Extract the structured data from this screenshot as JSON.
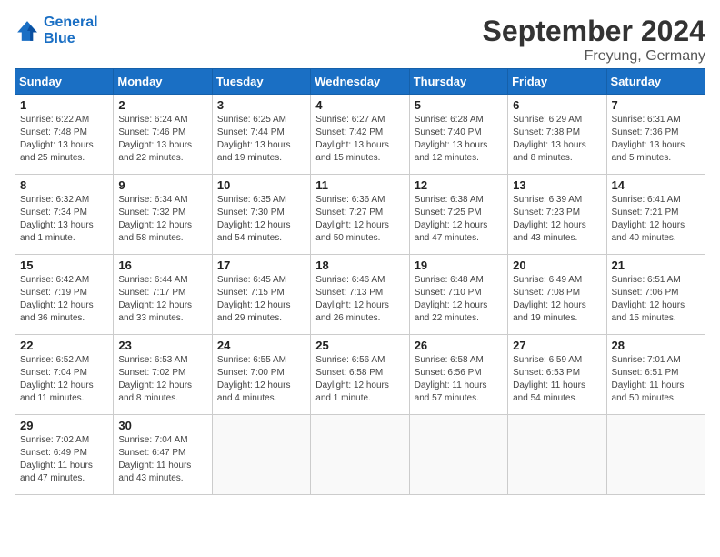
{
  "header": {
    "logo_line1": "General",
    "logo_line2": "Blue",
    "month_title": "September 2024",
    "location": "Freyung, Germany"
  },
  "days_of_week": [
    "Sunday",
    "Monday",
    "Tuesday",
    "Wednesday",
    "Thursday",
    "Friday",
    "Saturday"
  ],
  "weeks": [
    [
      {
        "day": 1,
        "sunrise": "6:22 AM",
        "sunset": "7:48 PM",
        "daylight": "13 hours and 25 minutes."
      },
      {
        "day": 2,
        "sunrise": "6:24 AM",
        "sunset": "7:46 PM",
        "daylight": "13 hours and 22 minutes."
      },
      {
        "day": 3,
        "sunrise": "6:25 AM",
        "sunset": "7:44 PM",
        "daylight": "13 hours and 19 minutes."
      },
      {
        "day": 4,
        "sunrise": "6:27 AM",
        "sunset": "7:42 PM",
        "daylight": "13 hours and 15 minutes."
      },
      {
        "day": 5,
        "sunrise": "6:28 AM",
        "sunset": "7:40 PM",
        "daylight": "13 hours and 12 minutes."
      },
      {
        "day": 6,
        "sunrise": "6:29 AM",
        "sunset": "7:38 PM",
        "daylight": "13 hours and 8 minutes."
      },
      {
        "day": 7,
        "sunrise": "6:31 AM",
        "sunset": "7:36 PM",
        "daylight": "13 hours and 5 minutes."
      }
    ],
    [
      {
        "day": 8,
        "sunrise": "6:32 AM",
        "sunset": "7:34 PM",
        "daylight": "13 hours and 1 minute."
      },
      {
        "day": 9,
        "sunrise": "6:34 AM",
        "sunset": "7:32 PM",
        "daylight": "12 hours and 58 minutes."
      },
      {
        "day": 10,
        "sunrise": "6:35 AM",
        "sunset": "7:30 PM",
        "daylight": "12 hours and 54 minutes."
      },
      {
        "day": 11,
        "sunrise": "6:36 AM",
        "sunset": "7:27 PM",
        "daylight": "12 hours and 50 minutes."
      },
      {
        "day": 12,
        "sunrise": "6:38 AM",
        "sunset": "7:25 PM",
        "daylight": "12 hours and 47 minutes."
      },
      {
        "day": 13,
        "sunrise": "6:39 AM",
        "sunset": "7:23 PM",
        "daylight": "12 hours and 43 minutes."
      },
      {
        "day": 14,
        "sunrise": "6:41 AM",
        "sunset": "7:21 PM",
        "daylight": "12 hours and 40 minutes."
      }
    ],
    [
      {
        "day": 15,
        "sunrise": "6:42 AM",
        "sunset": "7:19 PM",
        "daylight": "12 hours and 36 minutes."
      },
      {
        "day": 16,
        "sunrise": "6:44 AM",
        "sunset": "7:17 PM",
        "daylight": "12 hours and 33 minutes."
      },
      {
        "day": 17,
        "sunrise": "6:45 AM",
        "sunset": "7:15 PM",
        "daylight": "12 hours and 29 minutes."
      },
      {
        "day": 18,
        "sunrise": "6:46 AM",
        "sunset": "7:13 PM",
        "daylight": "12 hours and 26 minutes."
      },
      {
        "day": 19,
        "sunrise": "6:48 AM",
        "sunset": "7:10 PM",
        "daylight": "12 hours and 22 minutes."
      },
      {
        "day": 20,
        "sunrise": "6:49 AM",
        "sunset": "7:08 PM",
        "daylight": "12 hours and 19 minutes."
      },
      {
        "day": 21,
        "sunrise": "6:51 AM",
        "sunset": "7:06 PM",
        "daylight": "12 hours and 15 minutes."
      }
    ],
    [
      {
        "day": 22,
        "sunrise": "6:52 AM",
        "sunset": "7:04 PM",
        "daylight": "12 hours and 11 minutes."
      },
      {
        "day": 23,
        "sunrise": "6:53 AM",
        "sunset": "7:02 PM",
        "daylight": "12 hours and 8 minutes."
      },
      {
        "day": 24,
        "sunrise": "6:55 AM",
        "sunset": "7:00 PM",
        "daylight": "12 hours and 4 minutes."
      },
      {
        "day": 25,
        "sunrise": "6:56 AM",
        "sunset": "6:58 PM",
        "daylight": "12 hours and 1 minute."
      },
      {
        "day": 26,
        "sunrise": "6:58 AM",
        "sunset": "6:56 PM",
        "daylight": "11 hours and 57 minutes."
      },
      {
        "day": 27,
        "sunrise": "6:59 AM",
        "sunset": "6:53 PM",
        "daylight": "11 hours and 54 minutes."
      },
      {
        "day": 28,
        "sunrise": "7:01 AM",
        "sunset": "6:51 PM",
        "daylight": "11 hours and 50 minutes."
      }
    ],
    [
      {
        "day": 29,
        "sunrise": "7:02 AM",
        "sunset": "6:49 PM",
        "daylight": "11 hours and 47 minutes."
      },
      {
        "day": 30,
        "sunrise": "7:04 AM",
        "sunset": "6:47 PM",
        "daylight": "11 hours and 43 minutes."
      },
      null,
      null,
      null,
      null,
      null
    ]
  ]
}
